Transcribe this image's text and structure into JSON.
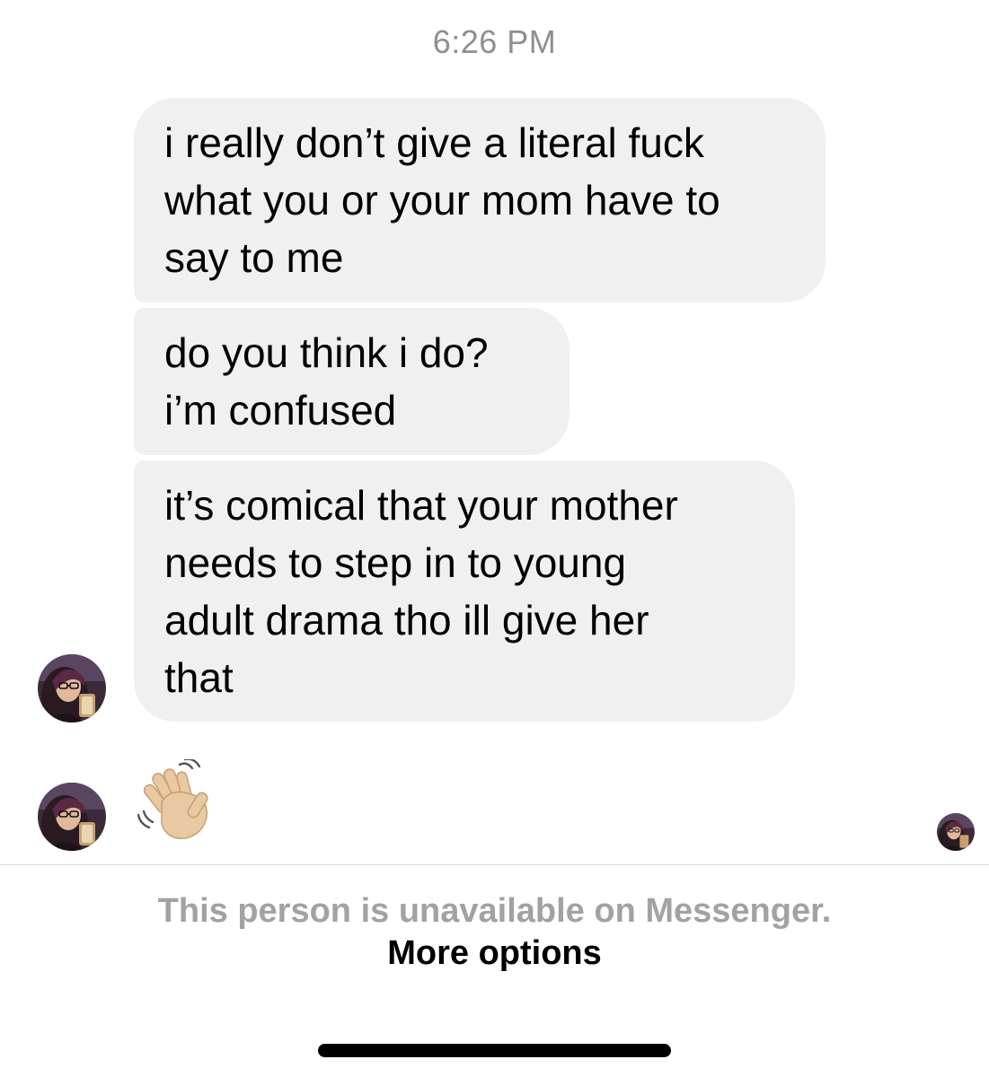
{
  "header": {
    "timestamp": "6:26 PM"
  },
  "messages": [
    {
      "lines": [
        "i really don’t give a literal fuck",
        "what you or your mom have to",
        "say to me"
      ]
    },
    {
      "lines": [
        "do you think i do?",
        "i’m confused"
      ]
    },
    {
      "lines": [
        "it’s comical that your mother",
        "needs to step in to young",
        "adult drama tho ill give her",
        "that"
      ]
    },
    {
      "emoji": "waving-hand-emoji"
    }
  ],
  "footer": {
    "unavailable_text": "This person is unavailable on Messenger.",
    "more_options_label": "More options"
  },
  "colors": {
    "bubble_background": "#f0f0f0",
    "timestamp_text": "#8e8e93",
    "unavailable_text": "#a2a2a6",
    "home_indicator": "#000000",
    "wave_skin": "#e9c9a2"
  }
}
